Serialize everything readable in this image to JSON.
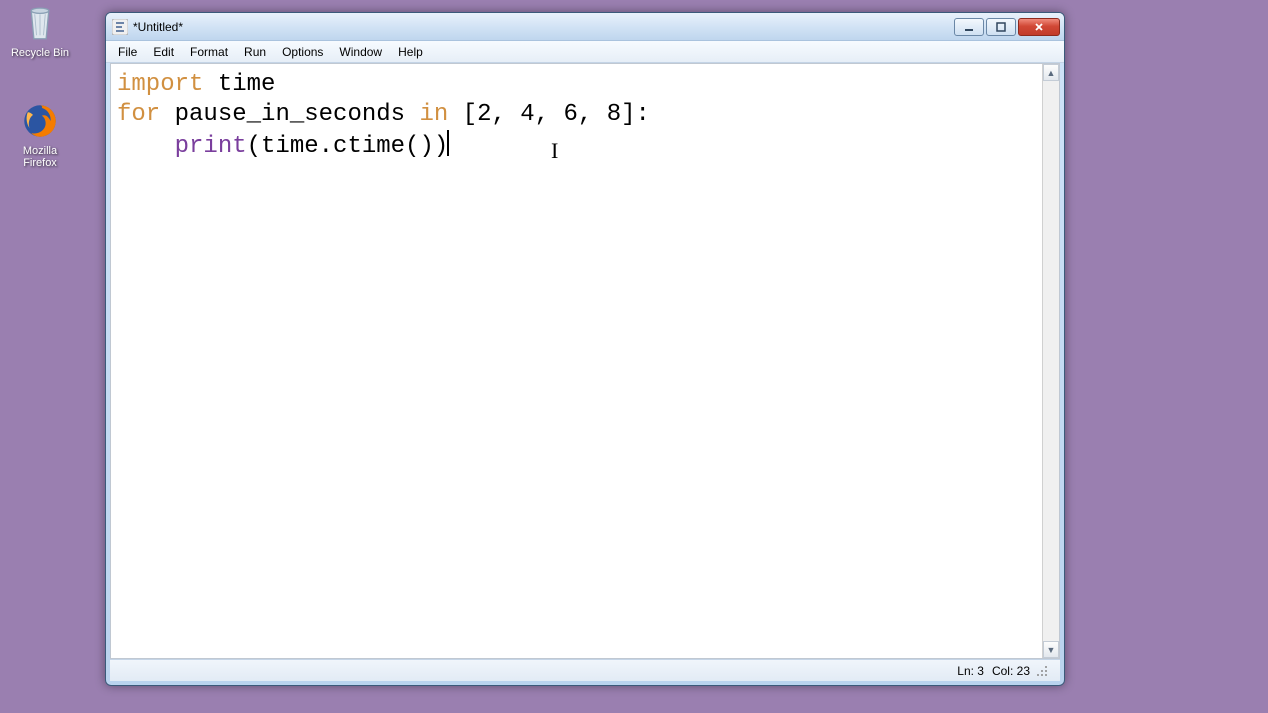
{
  "desktop": {
    "icons": [
      {
        "label": "Recycle Bin"
      },
      {
        "label": "Mozilla Firefox"
      }
    ]
  },
  "window": {
    "title": "*Untitled*",
    "menus": [
      "File",
      "Edit",
      "Format",
      "Run",
      "Options",
      "Window",
      "Help"
    ],
    "status": {
      "line_label": "Ln: 3",
      "col_label": "Col: 23"
    }
  },
  "code": {
    "line1_kw": "import",
    "line1_rest": " time",
    "line2_kw1": "for",
    "line2_mid": " pause_in_seconds ",
    "line2_kw2": "in",
    "line2_rest": " [2, 4, 6, 8]:",
    "line3_indent": "    ",
    "line3_builtin": "print",
    "line3_rest": "(time.ctime())"
  }
}
